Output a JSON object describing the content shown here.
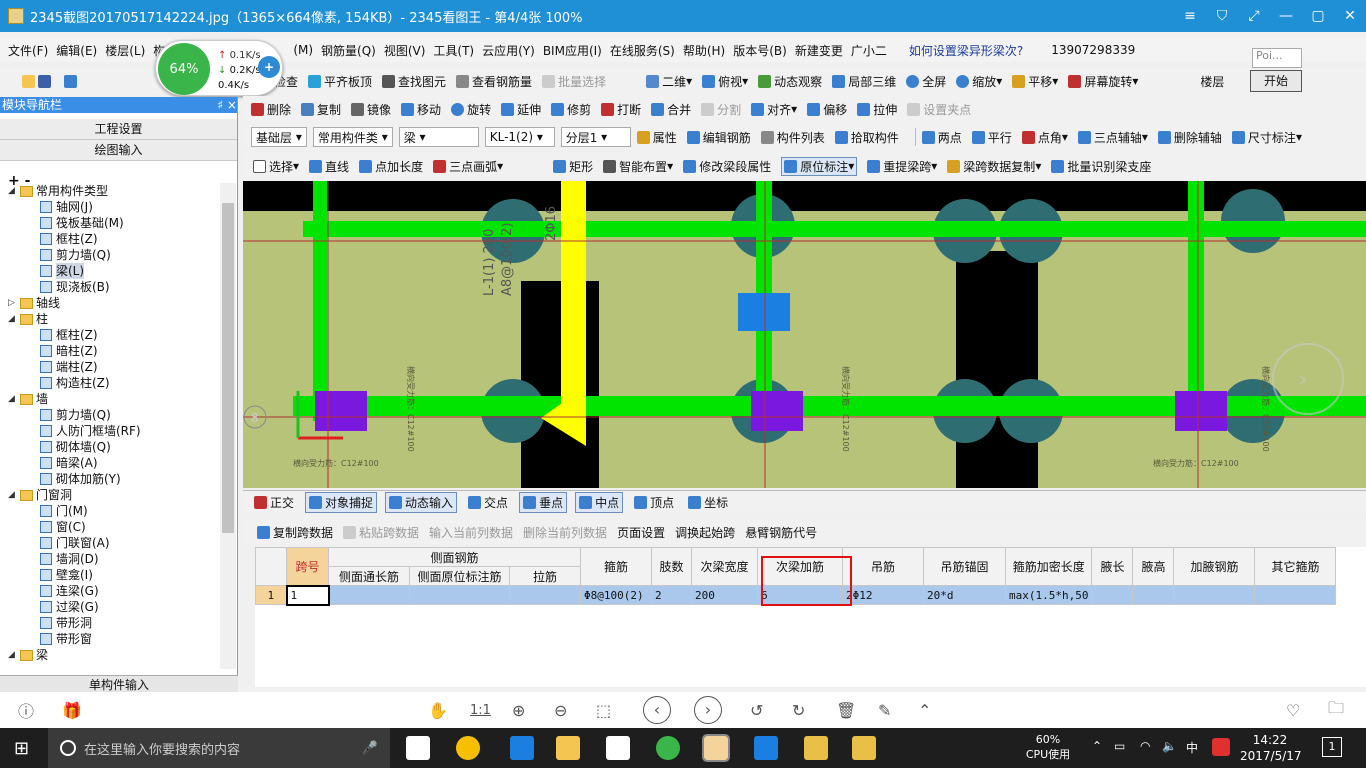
{
  "titlebar": {
    "title": "2345截图20170517142224.jpg（1365×664像素, 154KB）- 2345看图王 - 第4/4张 100%",
    "buttons": [
      "≡",
      "⛉",
      "⤢",
      "—",
      "▢",
      "✕"
    ]
  },
  "menu": [
    "文件(F)",
    "编辑(E)",
    "楼层(L)",
    "构件",
    "(M)",
    "钢筋量(Q)",
    "视图(V)",
    "工具(T)",
    "云应用(Y)",
    "BIM应用(I)",
    "在线服务(S)",
    "帮助(H)",
    "版本号(B)",
    "新建变更",
    "广小二",
    "如何设置梁异形梁次?",
    "13907298339",
    "Poi..."
  ],
  "speed": {
    "percent": "64%",
    "up": "0.1K/s",
    "down": "0.2K/s",
    "other": "0.4K/s",
    "plus": "+"
  },
  "start_button": "开始",
  "popup_text": "Poi...",
  "toolbar1": [
    "云检查",
    "平齐板顶",
    "查找图元",
    "查看钢筋量",
    "批量选择",
    "二维",
    "俯视",
    "动态观察",
    "局部三维",
    "全屏",
    "缩放",
    "平移",
    "屏幕旋转",
    "楼层"
  ],
  "toolbar2": [
    "删除",
    "复制",
    "镜像",
    "移动",
    "旋转",
    "延伸",
    "修剪",
    "打断",
    "合并",
    "分割",
    "对齐",
    "偏移",
    "拉伸",
    "设置夹点"
  ],
  "toolbar3": {
    "floor": "基础层",
    "type": "常用构件类",
    "comp": "梁",
    "name": "KL-1(2)",
    "layer": "分层1",
    "items": [
      "属性",
      "编辑钢筋",
      "构件列表",
      "拾取构件",
      "两点",
      "平行",
      "点角",
      "三点辅轴",
      "删除辅轴",
      "尺寸标注"
    ]
  },
  "toolbar4": [
    "选择",
    "直线",
    "点加长度",
    "三点画弧",
    "矩形",
    "智能布置",
    "修改梁段属性",
    "原位标注",
    "重提梁跨",
    "梁跨数据复制",
    "批量识别梁支座"
  ],
  "sidebar": {
    "title": "模块导航栏",
    "pin": "♯ ×",
    "btn1": "工程设置",
    "btn2": "绘图输入",
    "bottom": "单构件输入",
    "tree_tools": "+ -"
  },
  "tree": [
    {
      "label": "常用构件类型",
      "level": 0,
      "folder": true
    },
    {
      "label": "轴网(J)",
      "level": 1
    },
    {
      "label": "筏板基础(M)",
      "level": 1
    },
    {
      "label": "框柱(Z)",
      "level": 1
    },
    {
      "label": "剪力墙(Q)",
      "level": 1
    },
    {
      "label": "梁(L)",
      "level": 1,
      "selected": true
    },
    {
      "label": "现浇板(B)",
      "level": 1
    },
    {
      "label": "轴线",
      "level": 0,
      "folder": true
    },
    {
      "label": "柱",
      "level": 0,
      "folder": true
    },
    {
      "label": "框柱(Z)",
      "level": 1
    },
    {
      "label": "暗柱(Z)",
      "level": 1
    },
    {
      "label": "端柱(Z)",
      "level": 1
    },
    {
      "label": "构造柱(Z)",
      "level": 1
    },
    {
      "label": "墙",
      "level": 0,
      "folder": true
    },
    {
      "label": "剪力墙(Q)",
      "level": 1
    },
    {
      "label": "人防门框墙(RF)",
      "level": 1
    },
    {
      "label": "砌体墙(Q)",
      "level": 1
    },
    {
      "label": "暗梁(A)",
      "level": 1
    },
    {
      "label": "砌体加筋(Y)",
      "level": 1
    },
    {
      "label": "门窗洞",
      "level": 0,
      "folder": true
    },
    {
      "label": "门(M)",
      "level": 1
    },
    {
      "label": "窗(C)",
      "level": 1
    },
    {
      "label": "门联窗(A)",
      "level": 1
    },
    {
      "label": "墙洞(D)",
      "level": 1
    },
    {
      "label": "壁龛(I)",
      "level": 1
    },
    {
      "label": "连梁(G)",
      "level": 1
    },
    {
      "label": "过梁(G)",
      "level": 1
    },
    {
      "label": "带形洞",
      "level": 1
    },
    {
      "label": "带形窗",
      "level": 1
    },
    {
      "label": "梁",
      "level": 0,
      "folder": true
    }
  ],
  "canvas": {
    "axis_label": "8",
    "beam_text1": "L-1(1) 200",
    "beam_text2": "A8@100(2)",
    "beam_text3": "2Φ16",
    "rebar_label": "横向受力筋：C12#100",
    "rebar_vertical": "横向受力筋：C12#100"
  },
  "snapbar": [
    "正交",
    "对象捕捉",
    "动态输入",
    "交点",
    "垂点",
    "中点",
    "顶点",
    "坐标"
  ],
  "gridtoolbar": [
    "复制跨数据",
    "粘贴跨数据",
    "输入当前列数据",
    "删除当前列数据",
    "页面设置",
    "调换起始跨",
    "悬臂钢筋代号"
  ],
  "table": {
    "group_header": "侧面钢筋",
    "headers": [
      "跨号",
      "侧面通长筋",
      "侧面原位标注筋",
      "拉筋",
      "箍筋",
      "肢数",
      "次梁宽度",
      "次梁加筋",
      "吊筋",
      "吊筋锚固",
      "箍筋加密长度",
      "腋长",
      "腋高",
      "加腋钢筋",
      "其它箍筋"
    ],
    "rows": [
      {
        "num": "1",
        "cells": [
          "1",
          "",
          "",
          "",
          "Φ8@100(2)",
          "2",
          "200",
          "6",
          "2Φ12",
          "20*d",
          "max(1.5*h,50",
          "",
          "",
          "",
          ""
        ]
      }
    ]
  },
  "viewer": {
    "zoom_label": "1:1"
  },
  "taskbar": {
    "search": "在这里输入你要搜索的内容",
    "cpu_percent": "60%",
    "cpu_label": "CPU使用",
    "ime": "中",
    "time": "14:22",
    "date": "2017/5/17",
    "notif": "1"
  },
  "colors": {
    "title_bg": "#1f8fd6",
    "beam_green": "#00e400",
    "slab": "#b8c37a",
    "yellow": "#ffff00",
    "purple": "#7a18e0",
    "column": "#2e6e72",
    "taskbar": "#1e1e1e"
  }
}
